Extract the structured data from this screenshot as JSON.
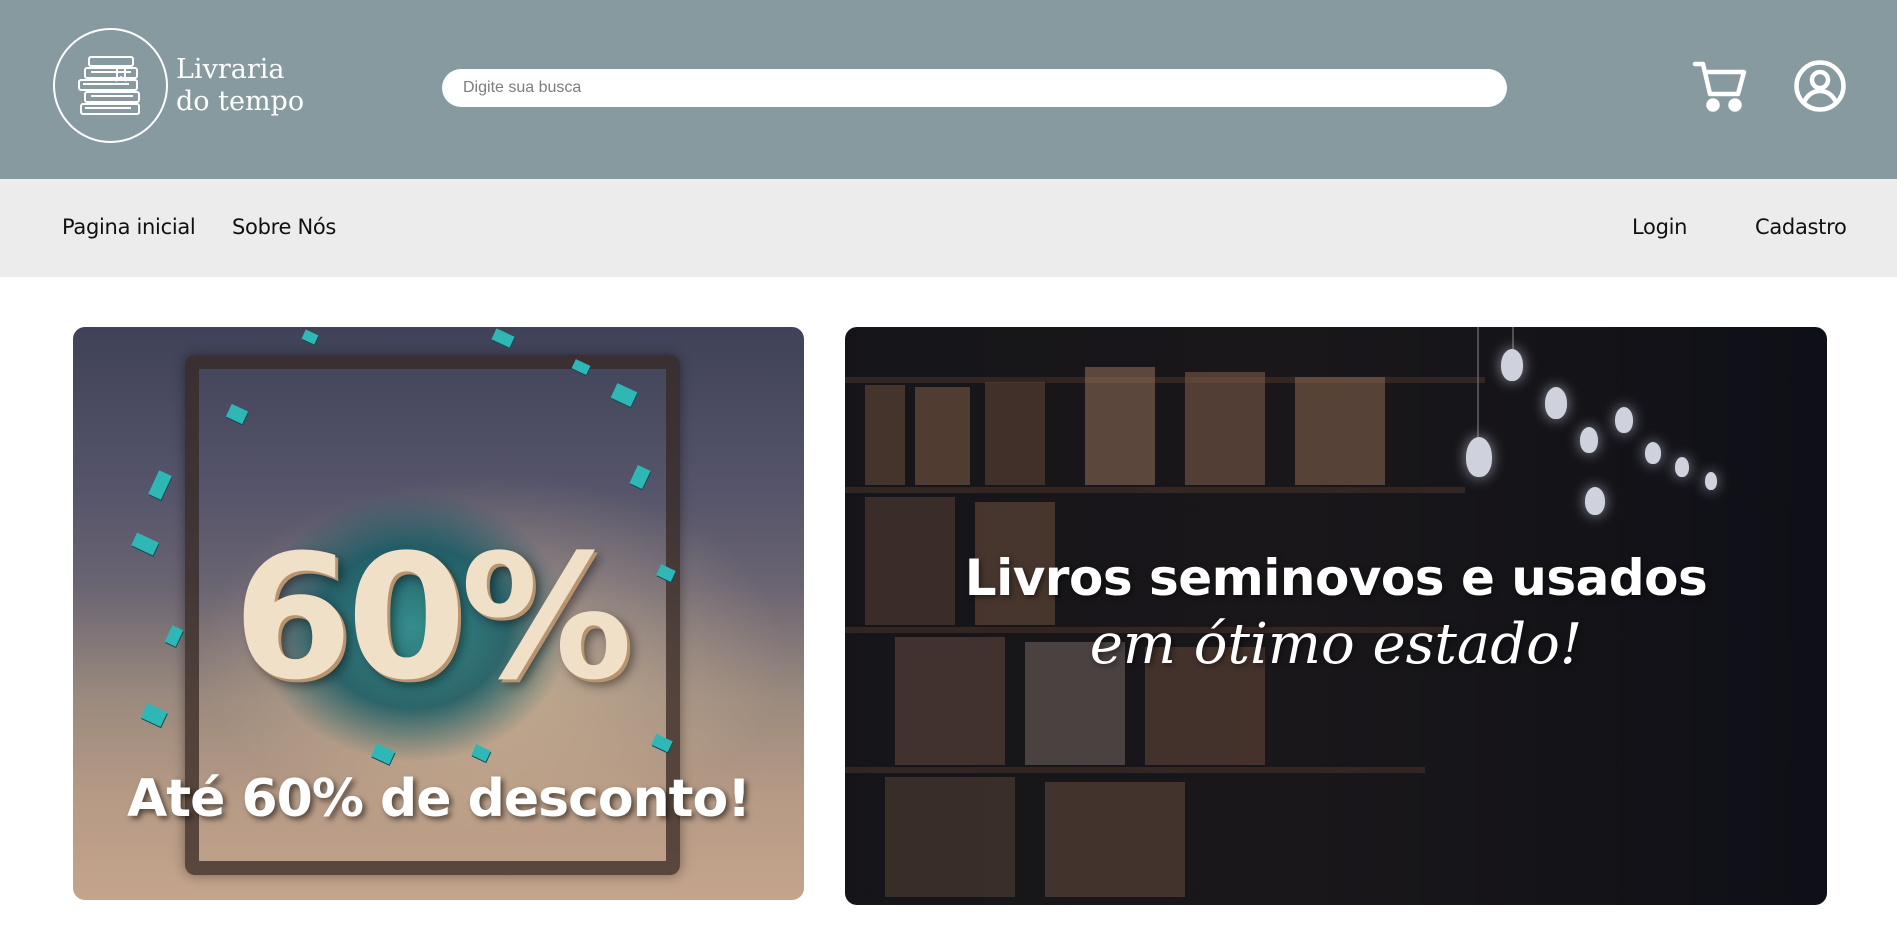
{
  "header": {
    "logo": {
      "line1": "Livraria",
      "line2": "do tempo",
      "icon": "book-stack-icon"
    },
    "search": {
      "placeholder": "Digite sua busca"
    },
    "cart_icon": "cart-icon",
    "user_icon": "user-circle-icon"
  },
  "nav": {
    "left": [
      {
        "label": "Pagina inicial"
      },
      {
        "label": "Sobre Nós"
      }
    ],
    "right": [
      {
        "label": "Login"
      },
      {
        "label": "Cadastro"
      }
    ]
  },
  "banners": {
    "left": {
      "big_text": "60%",
      "caption": "Até 60% de desconto!"
    },
    "right": {
      "line1": "Livros seminovos e usados",
      "line2": "em ótimo estado!"
    }
  },
  "colors": {
    "header_bg": "#879a9f",
    "nav_bg": "#ececec",
    "page_bg": "#ffffff"
  }
}
